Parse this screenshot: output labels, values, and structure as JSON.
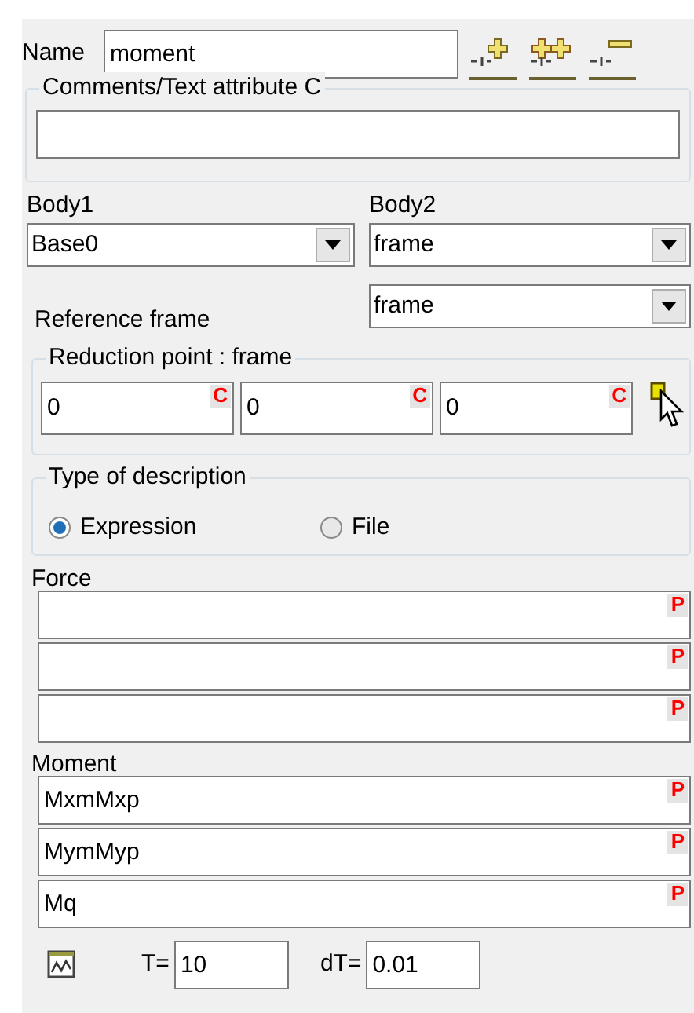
{
  "name": {
    "label": "Name",
    "value": "moment"
  },
  "comments": {
    "legend": "Comments/Text attribute C"
  },
  "body1": {
    "label": "Body1",
    "value": "Base0"
  },
  "body2": {
    "label": "Body2",
    "value": "frame"
  },
  "reference_frame": {
    "label": "Reference frame",
    "value": "frame"
  },
  "reduction_point": {
    "legend": "Reduction point : frame",
    "fields": [
      {
        "value": "0",
        "badge": "C"
      },
      {
        "value": "0",
        "badge": "C"
      },
      {
        "value": "0",
        "badge": "C"
      }
    ]
  },
  "description_type": {
    "legend": "Type of description",
    "options": [
      {
        "label": "Expression",
        "selected": true
      },
      {
        "label": "File",
        "selected": false
      }
    ]
  },
  "force": {
    "label": "Force",
    "fields": [
      {
        "badge": "P"
      },
      {
        "badge": "P"
      },
      {
        "badge": "P"
      }
    ]
  },
  "moment": {
    "label": "Moment",
    "fields": [
      {
        "value": "MxmMxp",
        "badge": "P"
      },
      {
        "value": "MymMyp",
        "badge": "P"
      },
      {
        "value": "Mq",
        "badge": "P"
      }
    ]
  },
  "time": {
    "t_label": "T=",
    "t_value": "10",
    "dt_label": "dT=",
    "dt_value": "0.01"
  }
}
